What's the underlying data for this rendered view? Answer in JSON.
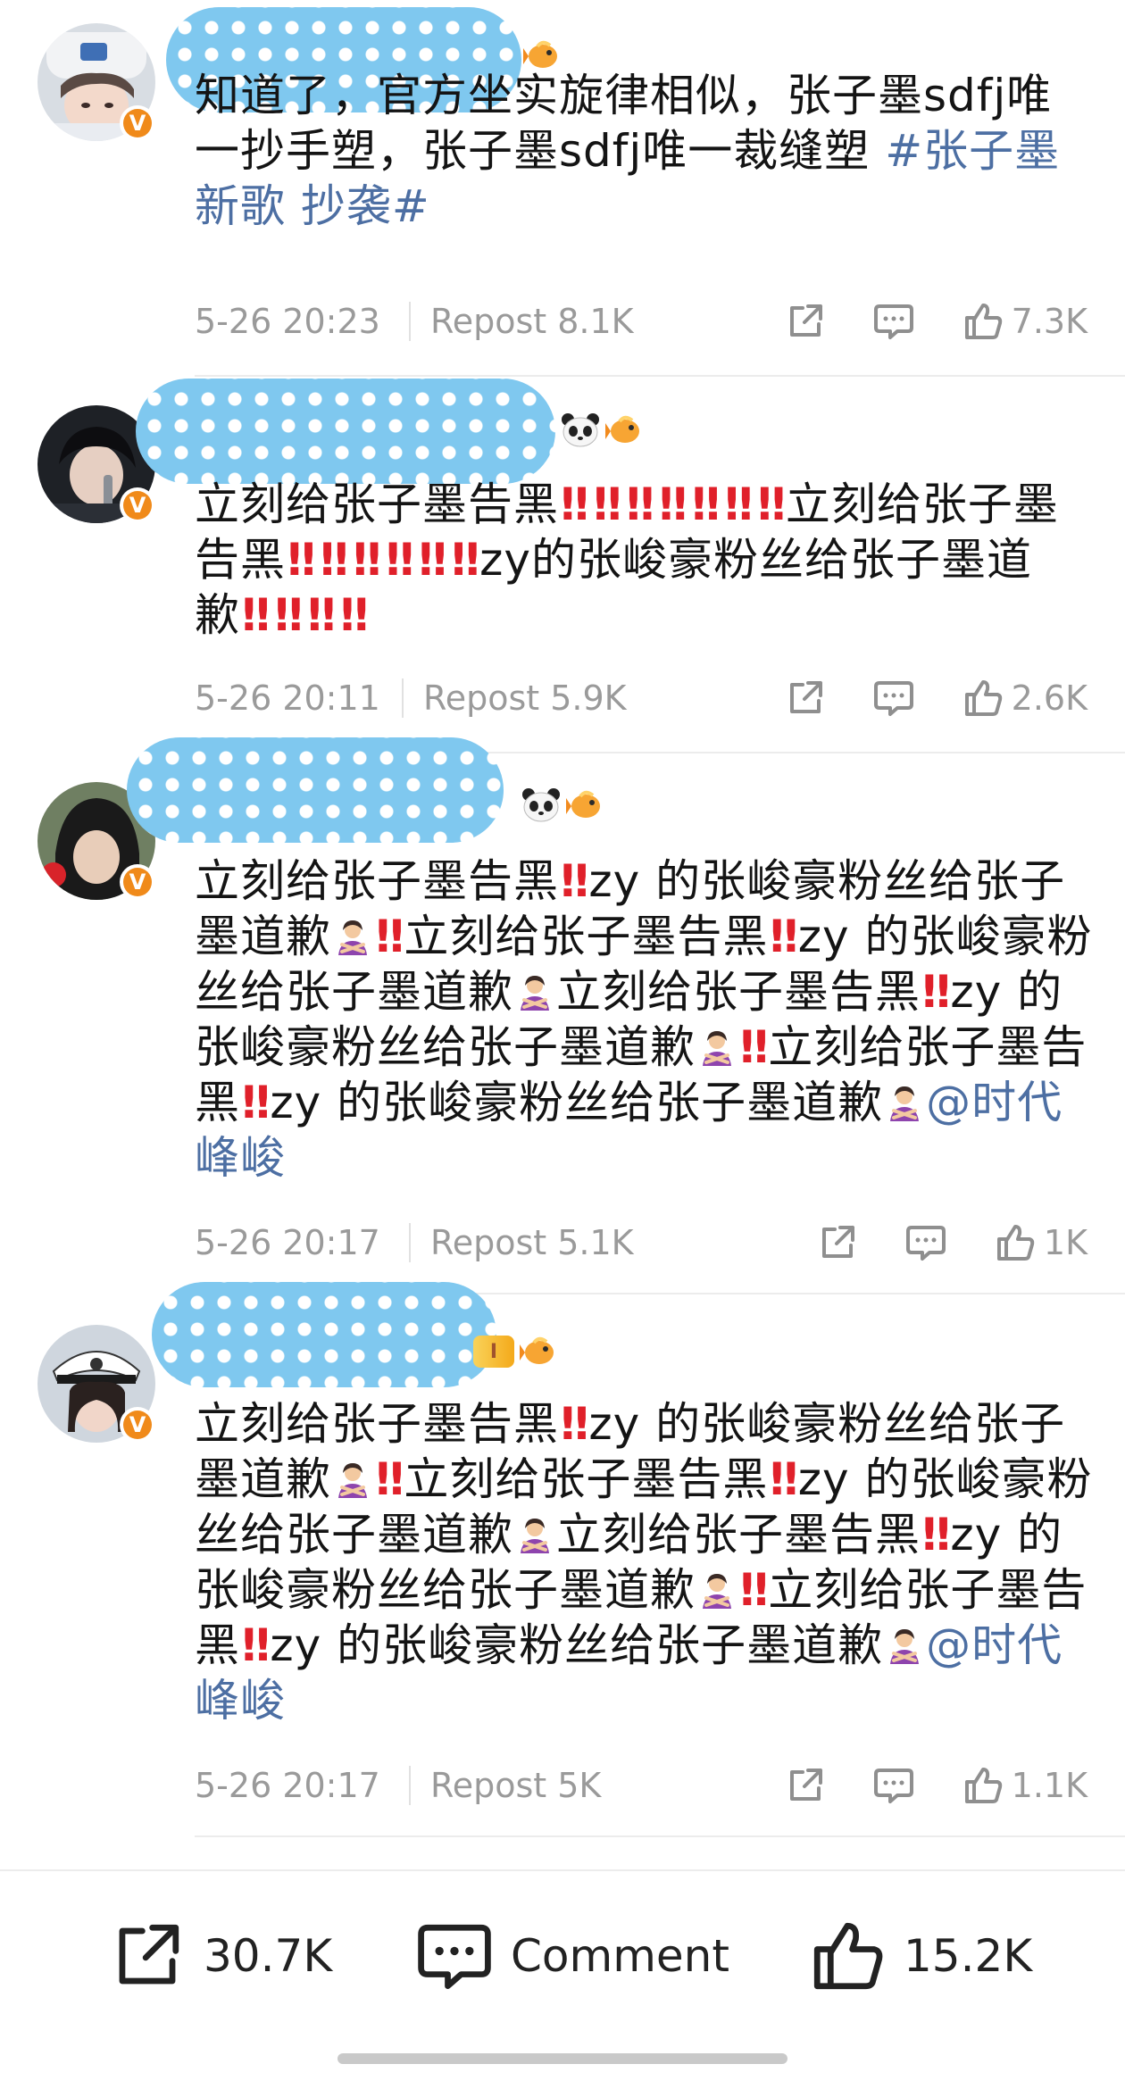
{
  "colors": {
    "link": "#4d6fa3",
    "meta": "#9a9a9a",
    "verified": "#f08a1a",
    "exclaim": "#e0202a"
  },
  "posts": [
    {
      "verified_badge": "V",
      "text_before": "知道了，官方坐实旋律相似，张子墨sdfj唯一抄手塑，张子墨sdfj唯一裁缝塑 ",
      "hashtag": "#张子墨新歌 抄袭#",
      "time": "5-26 20:23",
      "repost": "Repost 8.1K",
      "likes": "7.3K"
    },
    {
      "verified_badge": "V",
      "seg1": "立刻给张子墨告黑",
      "seg2": "立刻给张子墨告黑",
      "seg3": "zy的张峻豪粉丝给张子墨道歉",
      "time": "5-26 20:11",
      "repost": "Repost 5.9K",
      "likes": "2.6K"
    },
    {
      "verified_badge": "V",
      "s1": "立刻给张子墨告黑",
      "s2": "zy 的张峻豪粉丝给张子墨道歉",
      "s3": "立刻给张子墨告黑",
      "s4": "zy 的张峻豪粉丝给张子墨道歉",
      "s5": "立刻给张子墨告黑",
      "s6": "zy 的张峻豪粉丝给张子墨道歉",
      "s7": "立刻给张子墨告黑",
      "s8": "zy 的张峻豪粉丝给张子墨道歉",
      "mention": "@时代峰峻",
      "time": "5-26 20:17",
      "repost": "Repost 5.1K",
      "likes": "1K"
    },
    {
      "verified_badge": "V",
      "level_chip": "I",
      "s1": "立刻给张子墨告黑",
      "s2": "zy 的张峻豪粉丝给张子墨道歉",
      "s3": "立刻给张子墨告黑",
      "s4": "zy 的张峻豪粉丝给张子墨道歉",
      "s5": "立刻给张子墨告黑",
      "s6": "zy 的张峻豪粉丝给张子墨道歉",
      "s7": "立刻给张子墨告黑",
      "s8": "zy 的张峻豪粉丝给张子墨道歉",
      "mention": "@时代峰峻",
      "time": "5-26 20:17",
      "repost": "Repost 5K",
      "likes": "1.1K"
    }
  ],
  "bottom_bar": {
    "share_count": "30.7K",
    "comment_label": "Comment",
    "like_count": "15.2K"
  },
  "icons": [
    "share-icon",
    "comment-icon",
    "like-icon",
    "panda-icon",
    "fish-icon"
  ]
}
